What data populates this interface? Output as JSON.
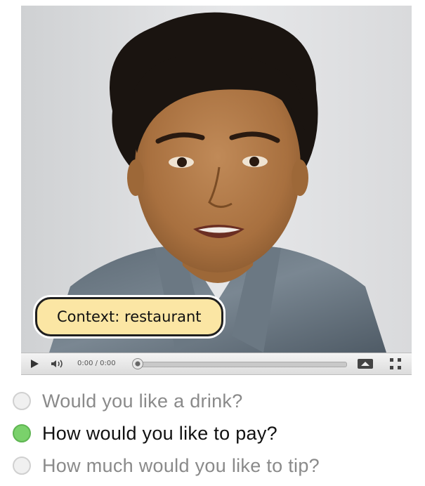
{
  "video": {
    "context_label": "Context: restaurant",
    "time_display": "0:00 / 0:00",
    "progress": 0
  },
  "options": [
    {
      "label": "Would you like a drink?",
      "selected": false
    },
    {
      "label": "How would you like to pay?",
      "selected": true
    },
    {
      "label": "How much would you like to tip?",
      "selected": false
    }
  ],
  "colors": {
    "selected_radio": "#7ad16b",
    "unselected_radio": "#f0f0f0",
    "context_pill": "#fbe6a4"
  }
}
